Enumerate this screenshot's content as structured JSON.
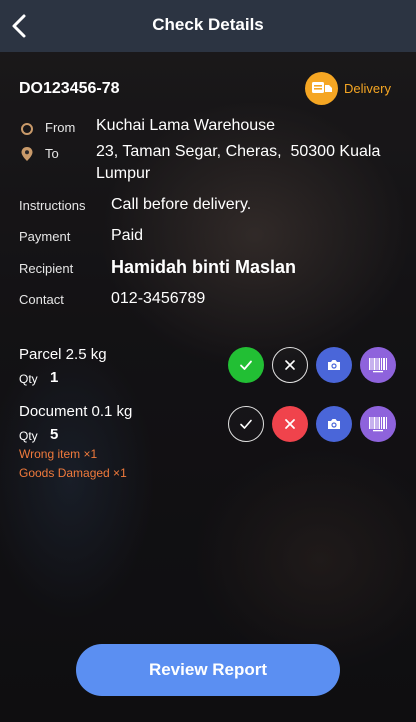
{
  "header": {
    "title": "Check Details",
    "back_icon": "chevron-left-icon"
  },
  "order": {
    "id": "DO123456-78",
    "type_label": "Delivery",
    "type_icon": "truck-delivery-icon",
    "accent": "#f5a623"
  },
  "route": {
    "from_label": "From",
    "from_value": "Kuchai Lama Warehouse",
    "to_label": "To",
    "to_line1": "23, Taman Segar, Cheras,  50300 Kuala",
    "to_line2": "Lumpur"
  },
  "details": {
    "instructions_label": "Instructions",
    "instructions_value": "Call before delivery.",
    "payment_label": "Payment",
    "payment_value": "Paid",
    "recipient_label": "Recipient",
    "recipient_value": "Hamidah binti Maslan",
    "contact_label": "Contact",
    "contact_value": "012-3456789"
  },
  "items": [
    {
      "name": "Parcel 2.5 kg",
      "qty_label": "Qty",
      "qty": "1",
      "status": "accepted",
      "issues": []
    },
    {
      "name": "Document 0.1 kg",
      "qty_label": "Qty",
      "qty": "5",
      "status": "rejected",
      "issues": [
        "Wrong item ×1",
        "Goods Damaged ×1"
      ]
    }
  ],
  "actions": {
    "review_label": "Review Report"
  },
  "colors": {
    "header_bg": "#2c3442",
    "accept_green": "#22bf34",
    "reject_red": "#f0434c",
    "camera_blue": "#4a66d9",
    "barcode_purple": "#8e63dc",
    "issue_orange": "#f07a3c",
    "button_blue": "#5b8ff2"
  }
}
